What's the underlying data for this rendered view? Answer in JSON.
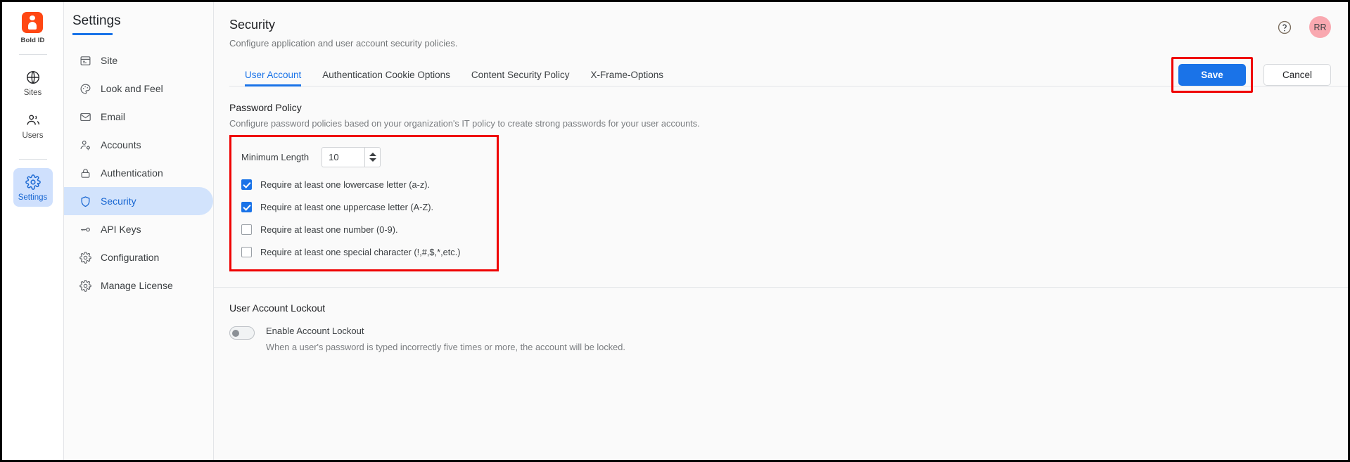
{
  "rail": {
    "brand": {
      "name": "Bold ID",
      "logo_color": "#ff4713"
    },
    "items": [
      {
        "label": "Sites",
        "icon": "globe-icon",
        "active": false
      },
      {
        "label": "Users",
        "icon": "users-icon",
        "active": false
      },
      {
        "label": "Settings",
        "icon": "gear-icon",
        "active": true
      }
    ]
  },
  "nav": {
    "title": "Settings",
    "accent": "#1a73e8",
    "items": [
      {
        "label": "Site",
        "icon": "site-icon",
        "active": false
      },
      {
        "label": "Look and Feel",
        "icon": "palette-icon",
        "active": false
      },
      {
        "label": "Email",
        "icon": "envelope-icon",
        "active": false
      },
      {
        "label": "Accounts",
        "icon": "account-gear-icon",
        "active": false
      },
      {
        "label": "Authentication",
        "icon": "lock-icon",
        "active": false
      },
      {
        "label": "Security",
        "icon": "shield-icon",
        "active": true
      },
      {
        "label": "API Keys",
        "icon": "key-icon",
        "active": false
      },
      {
        "label": "Configuration",
        "icon": "gear-icon",
        "active": false
      },
      {
        "label": "Manage License",
        "icon": "gear-icon",
        "active": false
      }
    ]
  },
  "header": {
    "title": "Security",
    "subtitle": "Configure application and user account security policies.",
    "help_icon": "help-circle-icon",
    "avatar_initials": "RR",
    "avatar_color": "#f9a8b0",
    "save_label": "Save",
    "cancel_label": "Cancel"
  },
  "tabs": [
    {
      "label": "User Account",
      "active": true
    },
    {
      "label": "Authentication Cookie Options",
      "active": false
    },
    {
      "label": "Content Security Policy",
      "active": false
    },
    {
      "label": "X-Frame-Options",
      "active": false
    }
  ],
  "password_policy": {
    "title": "Password Policy",
    "description": "Configure password policies based on your organization's IT policy to create strong passwords for your user accounts.",
    "min_length_label": "Minimum Length",
    "min_length_value": "10",
    "rules": [
      {
        "label": "Require at least one lowercase letter (a-z).",
        "checked": true
      },
      {
        "label": "Require at least one uppercase letter (A-Z).",
        "checked": true
      },
      {
        "label": "Require at least one number (0-9).",
        "checked": false
      },
      {
        "label": "Require at least one special character (!,#,$,*,etc.)",
        "checked": false
      }
    ]
  },
  "account_lockout": {
    "title": "User Account Lockout",
    "toggle_label": "Enable Account Lockout",
    "toggle_on": false,
    "description": "When a user's password is typed incorrectly five times or more, the account will be locked."
  },
  "annotations": {
    "highlight_color": "#ef0000"
  }
}
